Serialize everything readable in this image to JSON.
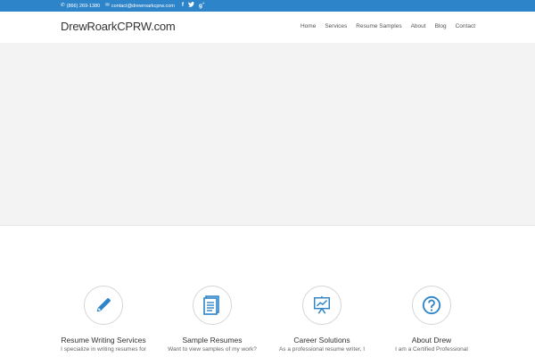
{
  "topbar": {
    "phone": "(866) 269-1380",
    "email": "contact@drewroarkcprw.com",
    "social_icons": [
      "facebook-icon",
      "twitter-icon",
      "google-plus-icon"
    ]
  },
  "header": {
    "logo": "DrewRoarkCPRW.com",
    "nav": [
      "Home",
      "Services",
      "Resume Samples",
      "About",
      "Blog",
      "Contact"
    ]
  },
  "colors": {
    "topbar": "#2e84c8",
    "icon_blue": "#2e84c8",
    "hero_bg": "#f3f3f3"
  },
  "features": [
    {
      "icon": "pencil-icon",
      "title": "Resume Writing Services",
      "desc": "I specialize in writing resumes for"
    },
    {
      "icon": "document-icon",
      "title": "Sample Resumes",
      "desc": "Want to view samples of my work?"
    },
    {
      "icon": "presentation-chart-icon",
      "title": "Career Solutions",
      "desc": "As a professional resume writer, I"
    },
    {
      "icon": "question-icon",
      "title": "About Drew",
      "desc": "I am a Certified Professional"
    }
  ]
}
